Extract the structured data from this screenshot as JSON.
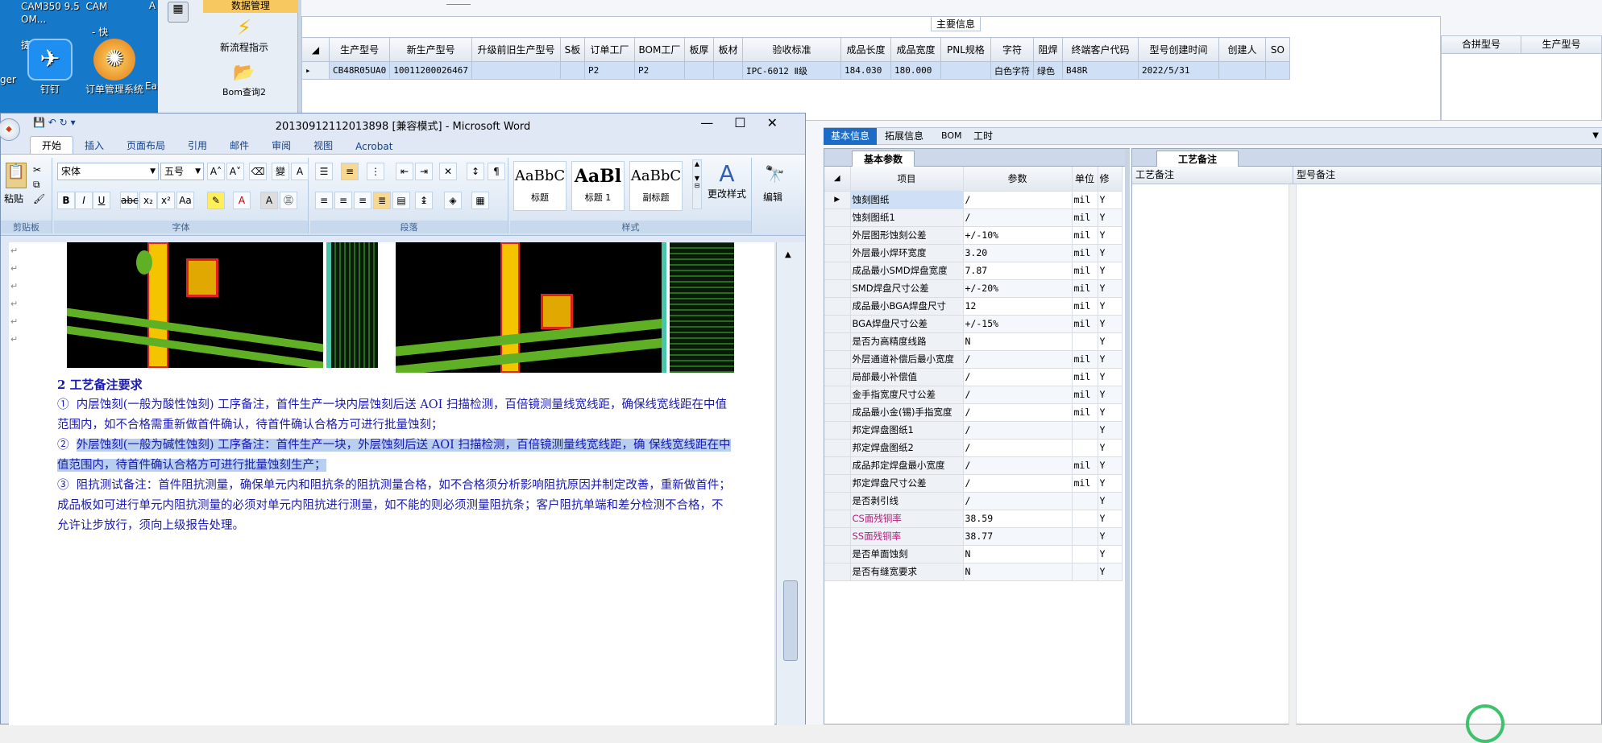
{
  "desktop": {
    "top_text": [
      "CAM350 9.5",
      "CAM OM...",
      "- 快捷方式"
    ],
    "left_partial_top": "A",
    "left_partial_label": "ger",
    "icons": [
      {
        "label": "钉钉"
      },
      {
        "label": "订单管理系统"
      },
      {
        "label": "Ea"
      }
    ]
  },
  "nav": {
    "header": "数据管理",
    "items": [
      {
        "label": "新流程指示"
      },
      {
        "label": "Bom查询2"
      }
    ]
  },
  "main_info": {
    "group_title": "主要信息",
    "columns": [
      "生产型号",
      "新生产型号",
      "升级前旧生产型号",
      "S板",
      "订单工厂",
      "BOM工厂",
      "板厚",
      "板材",
      "验收标准",
      "成品长度",
      "成品宽度",
      "PNL规格",
      "字符",
      "阻焊",
      "终端客户代码",
      "型号创建时间",
      "创建人",
      "SO"
    ],
    "row": [
      "CB48R05UA0",
      "10011200026467",
      "",
      "",
      "P2",
      "P2",
      "",
      "",
      "IPC-6012 Ⅱ级",
      "184.030",
      "180.000",
      "",
      "白色字符",
      "绿色",
      "B48R",
      "2022/5/31",
      "",
      ""
    ],
    "side_columns": [
      "合拼型号",
      "生产型号"
    ]
  },
  "tabs": [
    "基本信息",
    "拓展信息",
    "BOM",
    "工时"
  ],
  "basic_params": {
    "tab": "基本参数",
    "headers": [
      "项目",
      "参数",
      "单位",
      "修"
    ],
    "rows": [
      {
        "name": "蚀刻图纸",
        "value": "/",
        "unit": "mil",
        "flag": "Y",
        "color": "#000"
      },
      {
        "name": "蚀刻图纸1",
        "value": "/",
        "unit": "mil",
        "flag": "Y",
        "color": "#000"
      },
      {
        "name": "外层图形蚀刻公差",
        "value": "+/-10%",
        "unit": "mil",
        "flag": "Y",
        "color": "#000"
      },
      {
        "name": "外层最小焊环宽度",
        "value": "3.20",
        "unit": "mil",
        "flag": "Y",
        "color": "#000"
      },
      {
        "name": "成品最小SMD焊盘宽度",
        "value": "7.87",
        "unit": "mil",
        "flag": "Y",
        "color": "#000"
      },
      {
        "name": "SMD焊盘尺寸公差",
        "value": "+/-20%",
        "unit": "mil",
        "flag": "Y",
        "color": "#000"
      },
      {
        "name": "成品最小BGA焊盘尺寸",
        "value": "12",
        "unit": "mil",
        "flag": "Y",
        "color": "#000"
      },
      {
        "name": "BGA焊盘尺寸公差",
        "value": "+/-15%",
        "unit": "mil",
        "flag": "Y",
        "color": "#000"
      },
      {
        "name": "是否为高精度线路",
        "value": "N",
        "unit": "",
        "flag": "Y",
        "color": "#000"
      },
      {
        "name": "外层通道补偿后最小宽度",
        "value": "/",
        "unit": "mil",
        "flag": "Y",
        "color": "#000"
      },
      {
        "name": "局部最小补偿值",
        "value": "/",
        "unit": "mil",
        "flag": "Y",
        "color": "#000"
      },
      {
        "name": "金手指宽度尺寸公差",
        "value": "/",
        "unit": "mil",
        "flag": "Y",
        "color": "#000"
      },
      {
        "name": "成品最小金(锡)手指宽度",
        "value": "/",
        "unit": "mil",
        "flag": "Y",
        "color": "#000"
      },
      {
        "name": "邦定焊盘图纸1",
        "value": "/",
        "unit": "",
        "flag": "Y",
        "color": "#000"
      },
      {
        "name": "邦定焊盘图纸2",
        "value": "/",
        "unit": "",
        "flag": "Y",
        "color": "#000"
      },
      {
        "name": "成品邦定焊盘最小宽度",
        "value": "/",
        "unit": "mil",
        "flag": "Y",
        "color": "#000"
      },
      {
        "name": "邦定焊盘尺寸公差",
        "value": "/",
        "unit": "mil",
        "flag": "Y",
        "color": "#000"
      },
      {
        "name": "是否剥引线",
        "value": "/",
        "unit": "",
        "flag": "Y",
        "color": "#000"
      },
      {
        "name": "CS面残铜率",
        "value": "38.59",
        "unit": "",
        "flag": "Y",
        "color": "#b0207a"
      },
      {
        "name": "SS面残铜率",
        "value": "38.77",
        "unit": "",
        "flag": "Y",
        "color": "#b0207a"
      },
      {
        "name": "是否单面蚀刻",
        "value": "N",
        "unit": "",
        "flag": "Y",
        "color": "#000"
      },
      {
        "name": "是否有缝宽要求",
        "value": "N",
        "unit": "",
        "flag": "Y",
        "color": "#000"
      }
    ]
  },
  "process_notes": {
    "tab": "工艺备注",
    "col1": "工艺备注",
    "col2": "型号备注"
  },
  "word": {
    "title": "20130912112013898 [兼容模式] - Microsoft Word",
    "tabs": [
      "开始",
      "插入",
      "页面布局",
      "引用",
      "邮件",
      "审阅",
      "视图",
      "Acrobat"
    ],
    "font": "宋体",
    "size": "五号",
    "paste": "粘贴",
    "styles": [
      {
        "preview": "AaBbC",
        "name": "标题"
      },
      {
        "preview": "AaBl",
        "name": "标题 1"
      },
      {
        "preview": "AaBbC",
        "name": "副标题"
      }
    ],
    "change_styles": "更改样式",
    "edit": "编辑",
    "group_labels": [
      "剪贴板",
      "字体",
      "段落",
      "样式"
    ],
    "heading": "2 工艺备注要求",
    "items": [
      {
        "num": "①",
        "text": "内层蚀刻(一般为酸性蚀刻) 工序备注，首件生产一块内层蚀刻后送 AOI 扫描检测，百倍镜测量线宽线距，确保线宽线距在中值范围内，如不合格需重新做首件确认，待首件确认合格方可进行批量蚀刻；"
      },
      {
        "num": "②",
        "text": "外层蚀刻(一般为碱性蚀刻) 工序备注：首件生产一块，外层蚀刻后送 AOI 扫描检测，百倍镜测量线宽线距，确 保线宽线距在中值范围内，待首件确认合格方可进行批量蚀刻生产；"
      },
      {
        "num": "③",
        "text": "阻抗测试备注：首件阻抗测量，确保单元内和阻抗条的阻抗测量合格，如不合格须分析影响阻抗原因并制定改善，重新做首件；成品板如可进行单元内阻抗测量的必须对单元内阻抗进行测量，如不能的则必须测量阻抗条；客户阻抗单端和差分检测不合格，不允许让步放行，须向上级报告处理。"
      }
    ]
  }
}
